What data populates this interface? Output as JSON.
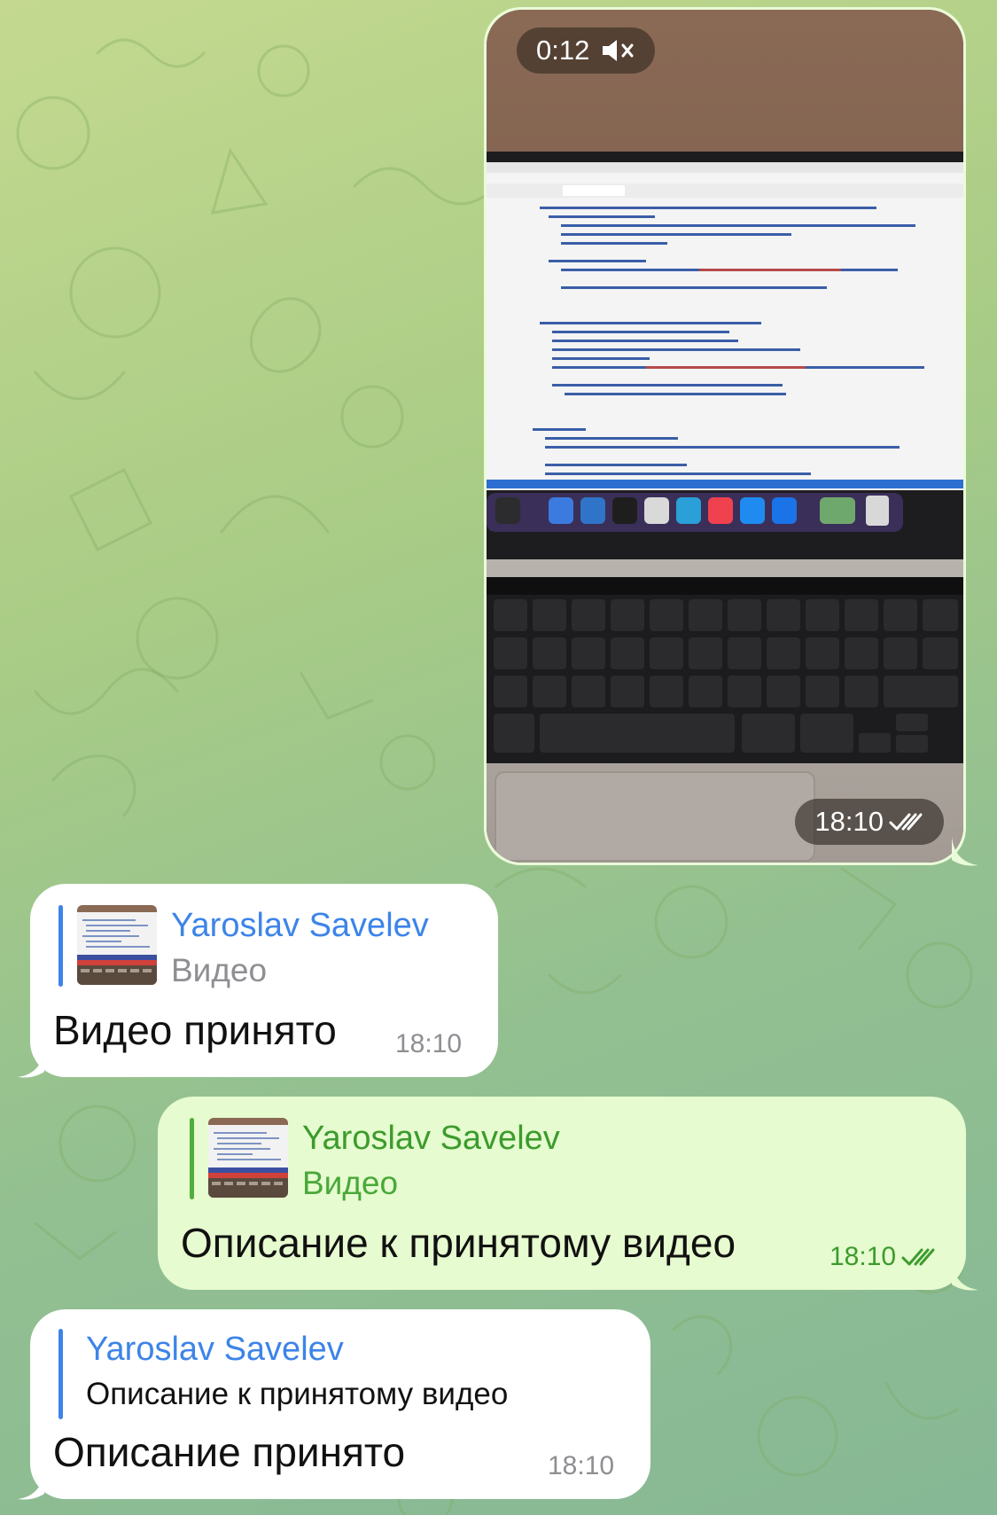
{
  "colors": {
    "incoming_bubble": "#ffffff",
    "outgoing_bubble": "#e6fbcf",
    "incoming_accent": "#3d84e8",
    "outgoing_accent": "#3c9b2d",
    "timestamp_incoming": "#8e8e93"
  },
  "messages": {
    "video": {
      "duration": "0:12",
      "time": "18:10",
      "muted_icon": "speaker-muted-icon",
      "status_icon": "double-check-icon"
    },
    "bot_reply_video": {
      "reply_author": "Yaroslav Savelev",
      "reply_preview": "Видео",
      "text": "Видео принято",
      "time": "18:10"
    },
    "user_description": {
      "reply_author": "Yaroslav Savelev",
      "reply_preview": "Видео",
      "text": "Описание к принятому видео",
      "time": "18:10",
      "status_icon": "double-check-icon"
    },
    "bot_reply_description": {
      "reply_author": "Yaroslav Savelev",
      "reply_preview": "Описание к принятому видео",
      "text": "Описание принято",
      "time": "18:10"
    }
  }
}
